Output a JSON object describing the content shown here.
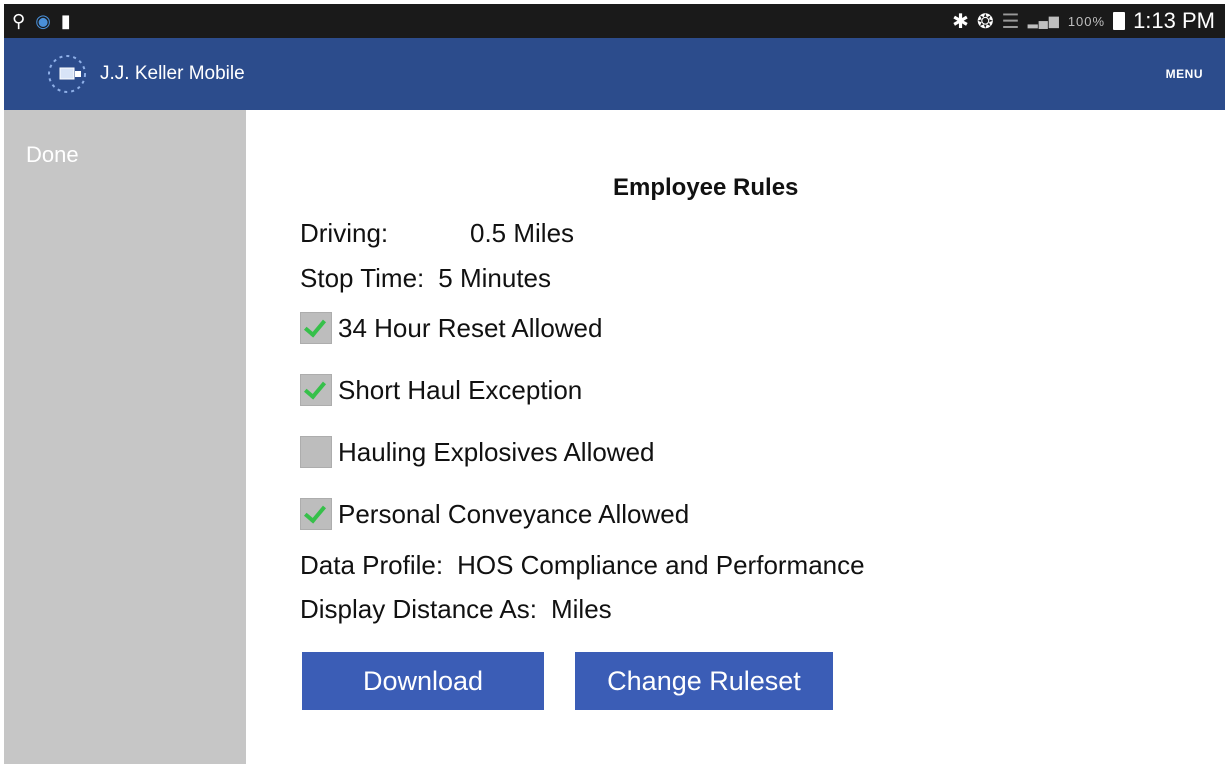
{
  "status_bar": {
    "battery_percent": "100%",
    "time": "1:13 PM"
  },
  "action_bar": {
    "app_title": "J.J. Keller Mobile",
    "menu_label": "MENU"
  },
  "sidebar": {
    "done_label": "Done"
  },
  "employee_rules": {
    "title": "Employee Rules",
    "driving_label": "Driving:",
    "driving_value": "0.5 Miles",
    "stop_time_label": "Stop Time:",
    "stop_time_value": "5 Minutes",
    "checkboxes": [
      {
        "label": "34 Hour Reset Allowed",
        "checked": true
      },
      {
        "label": "Short Haul Exception",
        "checked": true
      },
      {
        "label": "Hauling Explosives Allowed",
        "checked": false
      },
      {
        "label": "Personal Conveyance Allowed",
        "checked": true
      }
    ],
    "data_profile_label": "Data Profile:",
    "data_profile_value": "HOS Compliance and Performance",
    "display_distance_label": "Display Distance As:",
    "display_distance_value": "Miles"
  },
  "buttons": {
    "download_label": "Download",
    "change_ruleset_label": "Change Ruleset"
  },
  "colors": {
    "action_bar": "#2c4c8c",
    "button": "#3b5db6",
    "sidebar": "#c6c6c6",
    "checkmark": "#36c04a"
  },
  "icons": [
    "usb-icon",
    "sync-icon",
    "sd-card-icon",
    "bluetooth-icon",
    "nfc-icon",
    "wifi-icon",
    "signal-icon",
    "battery-icon",
    "app-logo-icon"
  ]
}
